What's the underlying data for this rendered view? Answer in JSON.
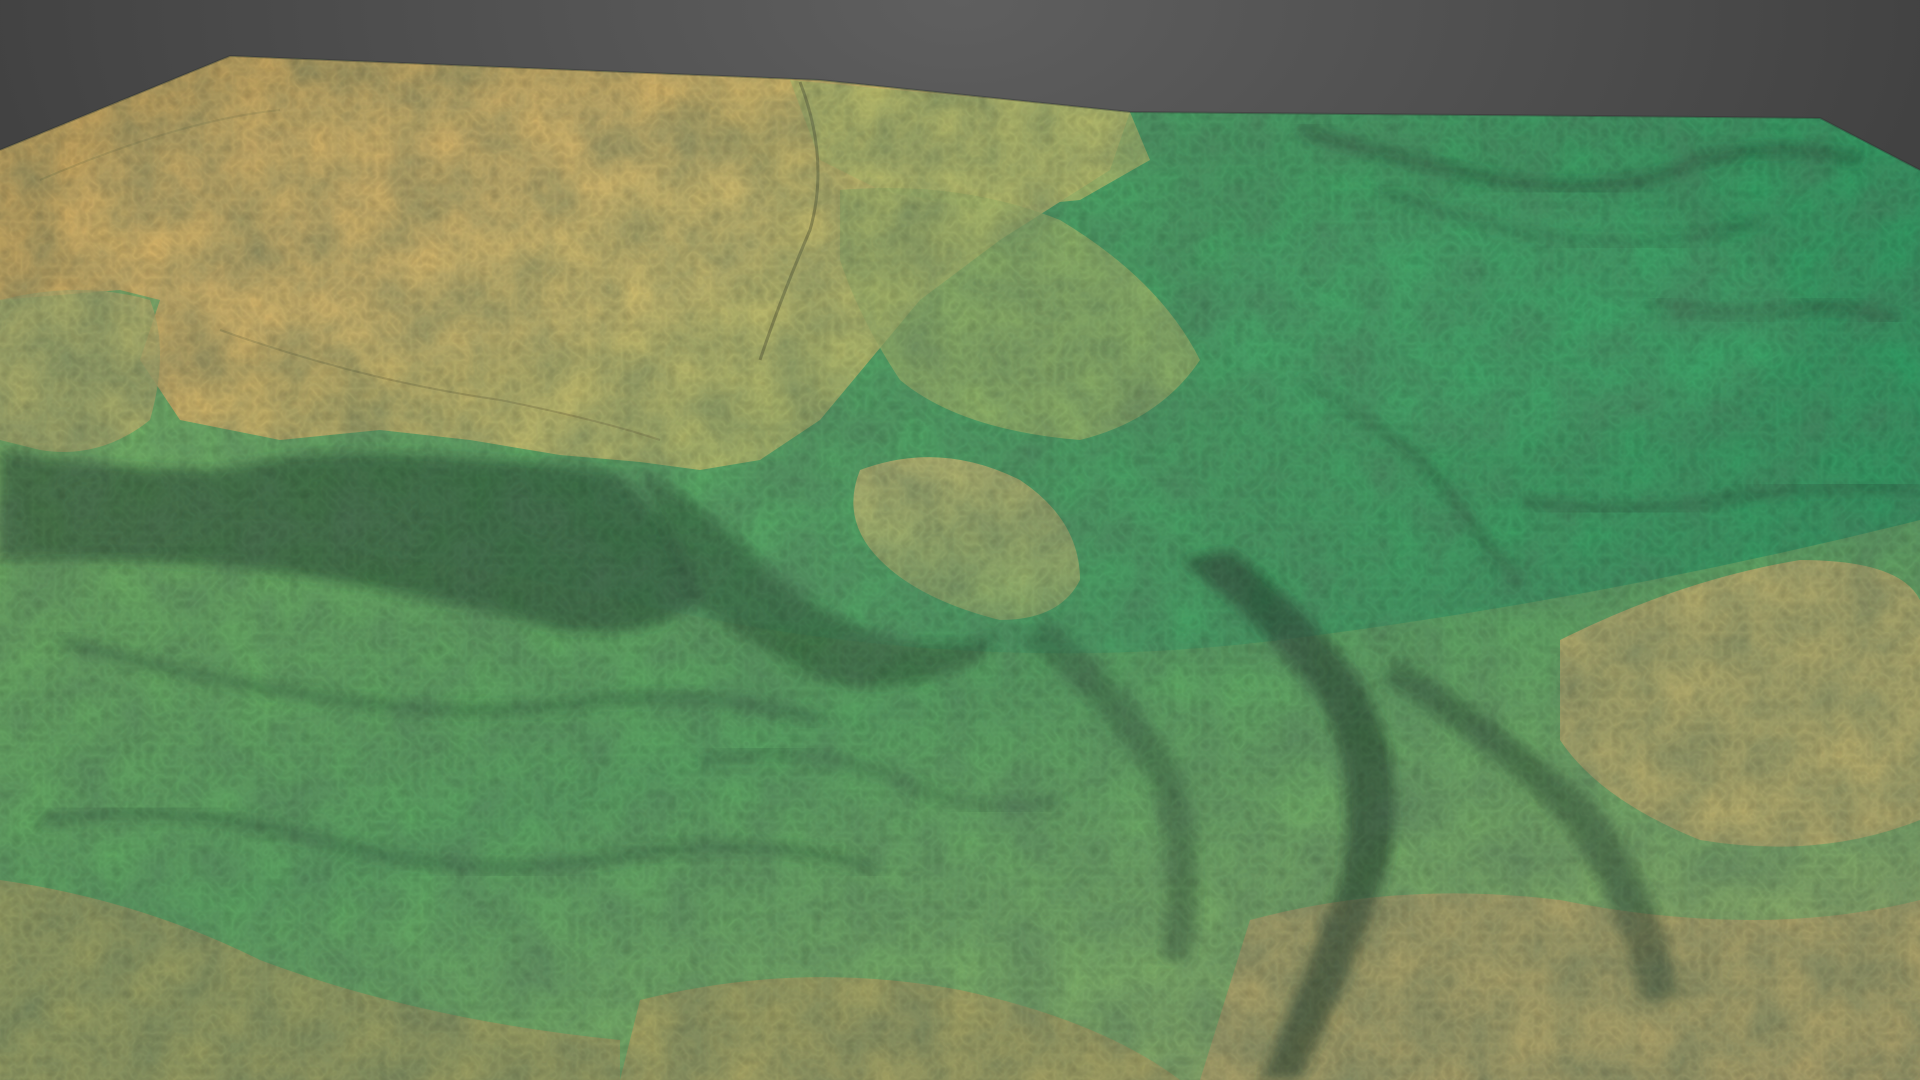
{
  "scene": {
    "subject": "3d-terrain-elevation-model",
    "colors": {
      "background_light": "#5a5a5a",
      "background_dark": "#2a2a2a",
      "plateau_high": "#d8a95a",
      "plateau_mid": "#c9b46a",
      "slope_yellow_green": "#a9bd6a",
      "valley_green": "#4fa865",
      "deep_green": "#2f9a62",
      "shadow": "#1f3a28"
    }
  }
}
